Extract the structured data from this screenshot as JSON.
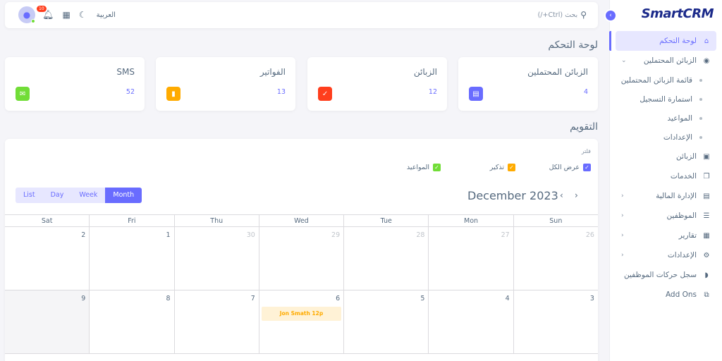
{
  "app": {
    "logo": "SmartCRM"
  },
  "navbar": {
    "search_placeholder": "بحث (Ctrl+/)",
    "language": "العربية",
    "notification_count": "10"
  },
  "sidebar": {
    "items": [
      {
        "label": "لوحة التحكم",
        "icon": "home-icon",
        "active": true
      },
      {
        "label": "الزبائن المحتملين",
        "icon": "user-circle-icon",
        "expanded": true
      },
      {
        "label": "قائمة الزبائن المحتملين",
        "sub": true
      },
      {
        "label": "استمارة التسجيل",
        "sub": true
      },
      {
        "label": "المواعيد",
        "sub": true
      },
      {
        "label": "الإعدادات",
        "sub": true
      },
      {
        "label": "الزبائن",
        "icon": "contacts-icon"
      },
      {
        "label": "الخدمات",
        "icon": "services-icon"
      },
      {
        "label": "الإدارة المالية",
        "icon": "money-icon",
        "chevron": true
      },
      {
        "label": "الموظفين",
        "icon": "employees-icon",
        "chevron": true
      },
      {
        "label": "تقارير",
        "icon": "report-icon",
        "chevron": true
      },
      {
        "label": "الإعدادات",
        "icon": "settings-icon",
        "chevron": true
      },
      {
        "label": "سجل حركات الموظفين",
        "icon": "log-icon"
      },
      {
        "label": "Add Ons",
        "icon": "addons-icon"
      }
    ]
  },
  "dashboard": {
    "title": "لوحة التحكم",
    "cards": [
      {
        "title": "الزبائن المحتملين",
        "value": "4",
        "color": "#696cff",
        "icon": "lead-card-icon"
      },
      {
        "title": "الزبائن",
        "value": "12",
        "color": "#ff3e1d",
        "icon": "customer-card-icon"
      },
      {
        "title": "الفواتير",
        "value": "13",
        "color": "#ffab00",
        "icon": "invoice-card-icon"
      },
      {
        "title": "SMS",
        "value": "52",
        "color": "#71dd37",
        "icon": "sms-card-icon"
      }
    ]
  },
  "calendar": {
    "title": "التقويم",
    "filter_label": "فلتر",
    "filters": [
      {
        "label": "عرض الكل",
        "color": "#696cff"
      },
      {
        "label": "تذكير",
        "color": "#ffab00"
      },
      {
        "label": "المواعيد",
        "color": "#71dd37"
      }
    ],
    "views": [
      "List",
      "Day",
      "Week",
      "Month"
    ],
    "active_view": "Month",
    "month_title": "December 2023",
    "weekdays": [
      "Sat",
      "Fri",
      "Thu",
      "Wed",
      "Tue",
      "Mon",
      "Sun"
    ],
    "weeks": [
      [
        "2",
        "1",
        "30",
        "29",
        "28",
        "27",
        "26"
      ],
      [
        "9",
        "8",
        "7",
        "6",
        "5",
        "4",
        "3"
      ]
    ],
    "event": {
      "text": "Jon Smath  12p",
      "date": "6"
    }
  }
}
